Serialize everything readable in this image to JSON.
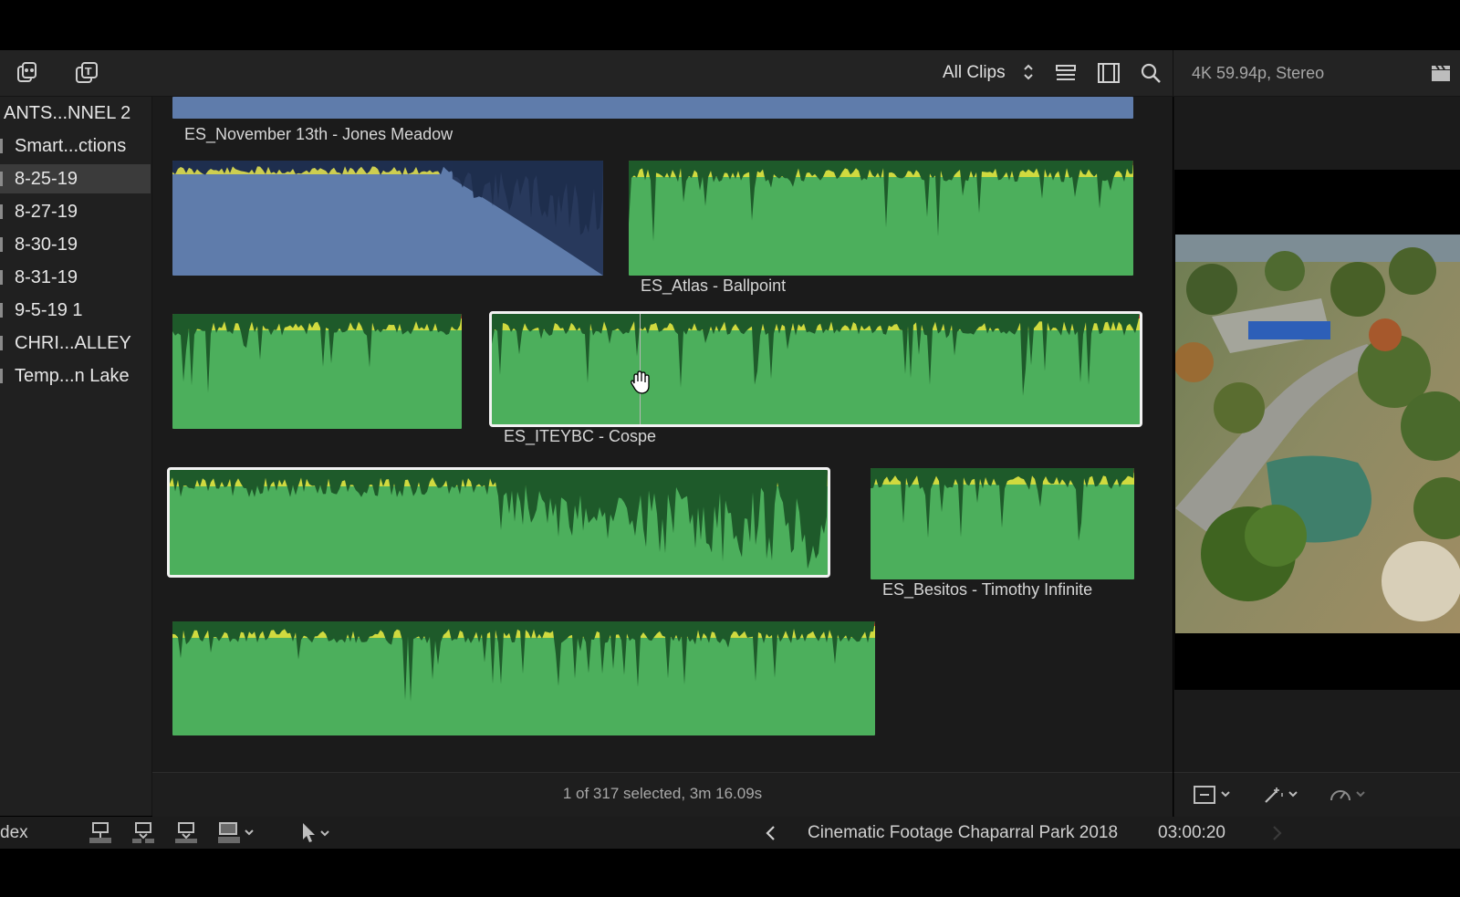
{
  "toolbar": {
    "filter_label": "All Clips",
    "viewer_format": "4K 59.94p, Stereo"
  },
  "sidebar": {
    "items": [
      {
        "label": "ANTS...NNEL 2"
      },
      {
        "label": "Smart...ctions"
      },
      {
        "label": "8-25-19"
      },
      {
        "label": "8-27-19"
      },
      {
        "label": "8-30-19"
      },
      {
        "label": "8-31-19"
      },
      {
        "label": "9-5-19 1"
      },
      {
        "label": "CHRI...ALLEY"
      },
      {
        "label": "Temp...n Lake"
      }
    ]
  },
  "clips": [
    {
      "name": "ES_November 13th - Jones Meadow"
    },
    {
      "name": "ES_Atlas - Ballpoint"
    },
    {
      "name": "ES_ITEYBC - Cospe"
    },
    {
      "name": "ES_Besitos - Timothy Infinite"
    }
  ],
  "status": {
    "selection_text": "1 of 317 selected, 3m 16.09s"
  },
  "timeline": {
    "index_label": "dex",
    "project_name": "Cinematic Footage Chaparral Park 2018",
    "duration": "03:00:20"
  },
  "colors": {
    "audio_green": "#4caf5c",
    "audio_dark_green": "#1e5a2a",
    "audio_blue": "#5f7cab",
    "audio_dark_blue": "#1e2e4e",
    "peak_yellow": "#e8e23a",
    "peak_red": "#e22a1f",
    "selection_white": "#f2f2f2"
  }
}
